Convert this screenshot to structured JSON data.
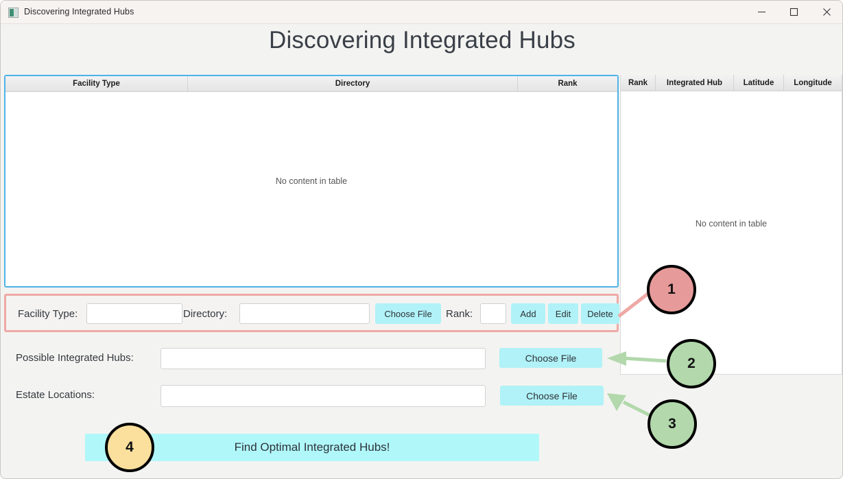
{
  "window": {
    "title": "Discovering Integrated Hubs",
    "icon": "app-icon",
    "controls": {
      "minimize": "minimize-icon",
      "maximize": "maximize-icon",
      "close": "close-icon"
    }
  },
  "heading": "Discovering Integrated Hubs",
  "left_table": {
    "columns": [
      "Facility Type",
      "Directory",
      "Rank"
    ],
    "rows": [],
    "empty_message": "No content in table"
  },
  "right_table": {
    "columns": [
      "Rank",
      "Integrated Hub",
      "Latitude",
      "Longitude"
    ],
    "rows": [],
    "empty_message": "No content in table"
  },
  "entry_row": {
    "facility_type_label": "Facility Type:",
    "facility_type_value": "",
    "directory_label": "Directory:",
    "directory_value": "",
    "choose_file_label": "Choose File",
    "rank_label": "Rank:",
    "rank_value": "",
    "add_label": "Add",
    "edit_label": "Edit",
    "delete_label": "Delete"
  },
  "file_rows": [
    {
      "label": "Possible Integrated Hubs:",
      "value": "",
      "button": "Choose File"
    },
    {
      "label": "Estate Locations:",
      "value": "",
      "button": "Choose File"
    }
  ],
  "primary_action": "Find Optimal Integrated Hubs!",
  "annotations": [
    {
      "number": "1",
      "color": "#e79a9a",
      "target": "entry-row"
    },
    {
      "number": "2",
      "color": "#b2d8ac",
      "target": "choose-file-possible-hubs"
    },
    {
      "number": "3",
      "color": "#b2d8ac",
      "target": "choose-file-estate-locations"
    },
    {
      "number": "4",
      "color": "#fbdf9d",
      "target": "find-optimal-hubs-button"
    }
  ],
  "colors": {
    "accent_cyan": "#b0f2f7",
    "focus_blue": "#4db3e8",
    "highlight_red": "#eea9a6",
    "arrow_green": "#b2d8ac"
  }
}
